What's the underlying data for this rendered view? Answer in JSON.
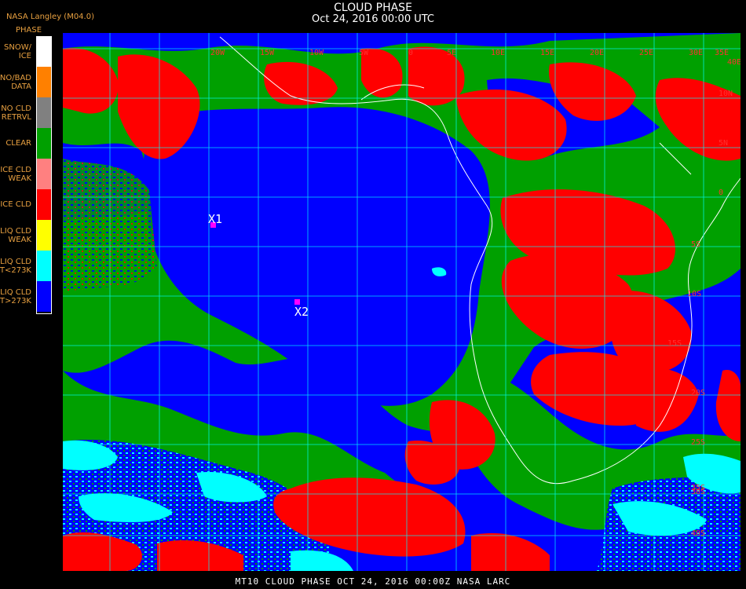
{
  "header": {
    "title": "CLOUD PHASE",
    "subtitle": "Oct 24, 2016 00:00 UTC",
    "producer": "NASA Langley (M04.0)"
  },
  "legend": {
    "title": "PHASE",
    "items": [
      {
        "label_l1": "SNOW/",
        "label_l2": "ICE",
        "color": "#ffffff"
      },
      {
        "label_l1": "NO/BAD",
        "label_l2": "DATA",
        "color": "#ff8000"
      },
      {
        "label_l1": "NO CLD",
        "label_l2": "RETRVL",
        "color": "#808080"
      },
      {
        "label_l1": "CLEAR",
        "label_l2": "",
        "color": "#00a000"
      },
      {
        "label_l1": "ICE CLD",
        "label_l2": "WEAK",
        "color": "#ff8080"
      },
      {
        "label_l1": "ICE CLD",
        "label_l2": "",
        "color": "#ff0000"
      },
      {
        "label_l1": "LIQ CLD",
        "label_l2": "WEAK",
        "color": "#ffff00"
      },
      {
        "label_l1": "LIQ CLD",
        "label_l2": "T<273K",
        "color": "#00ffff"
      },
      {
        "label_l1": "LIQ CLD",
        "label_l2": "T>273K",
        "color": "#0000ff"
      }
    ]
  },
  "map": {
    "grid_labels": {
      "top": [
        "20W",
        "15W",
        "10W",
        "5W",
        "0",
        "5E",
        "10E",
        "15E",
        "20E",
        "25E",
        "30E",
        "35E",
        "40E"
      ],
      "right": [
        "10N",
        "5N",
        "0",
        "5S",
        "10S",
        "15S",
        "20S",
        "25S",
        "30S",
        "35S",
        "40S"
      ]
    },
    "markers": [
      {
        "label": "X1",
        "color": "#ff00ff"
      },
      {
        "label": "X2",
        "color": "#ff00ff"
      }
    ]
  },
  "footer": {
    "text": "MT10  CLOUD PHASE  OCT 24, 2016 00:00Z  NASA LARC"
  }
}
